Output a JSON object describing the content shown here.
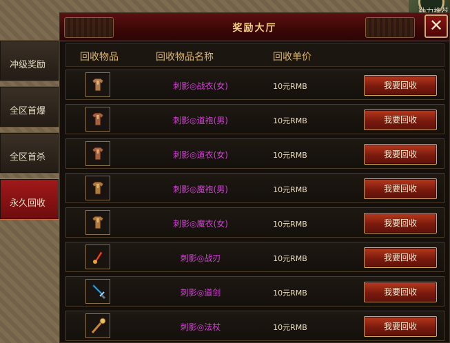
{
  "corner": {
    "text": "勤力推荐"
  },
  "tabs": [
    {
      "label": "冲级奖励",
      "active": false
    },
    {
      "label": "全区首爆",
      "active": false
    },
    {
      "label": "全区首杀",
      "active": false
    },
    {
      "label": "永久回收",
      "active": true
    }
  ],
  "window": {
    "title": "奖励大厅",
    "close_symbol": "✕"
  },
  "table": {
    "headers": [
      "回收物品",
      "回收物品名称",
      "回收单价"
    ],
    "rows": [
      {
        "icon": "armor-icon",
        "name": "刺影◎战衣(女)",
        "price": "10元RMB",
        "button": "我要回收",
        "name_color": "#d43fd8",
        "icon_color": "#b07a4a"
      },
      {
        "icon": "armor-icon",
        "name": "刺影◎道袍(男)",
        "price": "10元RMB",
        "button": "我要回收",
        "name_color": "#d43fd8",
        "icon_color": "#a9603e"
      },
      {
        "icon": "armor-icon",
        "name": "刺影◎道衣(女)",
        "price": "10元RMB",
        "button": "我要回收",
        "name_color": "#d43fd8",
        "icon_color": "#a9603e"
      },
      {
        "icon": "armor-icon",
        "name": "刺影◎魔袍(男)",
        "price": "10元RMB",
        "button": "我要回收",
        "name_color": "#d43fd8",
        "icon_color": "#b27a3a"
      },
      {
        "icon": "armor-icon",
        "name": "刺影◎魔衣(女)",
        "price": "10元RMB",
        "button": "我要回收",
        "name_color": "#d43fd8",
        "icon_color": "#b27a3a"
      },
      {
        "icon": "blade-icon",
        "name": "刺影◎战刃",
        "price": "10元RMB",
        "button": "我要回收",
        "name_color": "#d43fd8",
        "icon_color": "#e04a1a"
      },
      {
        "icon": "sword-icon",
        "name": "刺影◎道剑",
        "price": "10元RMB",
        "button": "我要回收",
        "name_color": "#d43fd8",
        "icon_color": "#3aa8e8"
      },
      {
        "icon": "staff-icon",
        "name": "刺影◎法杖",
        "price": "10元RMB",
        "button": "我要回收",
        "name_color": "#d43fd8",
        "icon_color": "#c9873a"
      }
    ]
  }
}
